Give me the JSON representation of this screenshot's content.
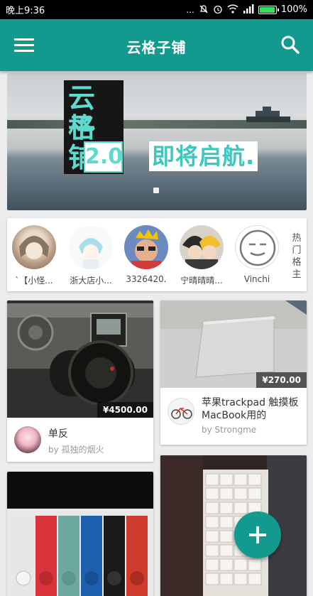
{
  "status_bar": {
    "time": "晚上9:36",
    "dots": "...",
    "battery": "100%",
    "battery_level": 1.0
  },
  "app_bar": {
    "title": "云格子铺",
    "menu_icon": "menu-icon",
    "search_icon": "search-icon",
    "color": "#139a8e"
  },
  "banner": {
    "logo_line1": "云格",
    "logo_line2": "子铺",
    "version": "2.0",
    "tagline": "即将启航."
  },
  "hot_users": {
    "label": "热门格主",
    "users": [
      {
        "name": "`【小怪..."
      },
      {
        "name": "浙大店小..."
      },
      {
        "name": "3326420."
      },
      {
        "name": "宁晴晴晴..."
      },
      {
        "name": "Vinchi"
      }
    ]
  },
  "cards": [
    {
      "price": "¥4500.00",
      "title": "单反",
      "by": "by 孤独的烟火"
    },
    {
      "price": "¥270.00",
      "title": "苹果trackpad 触摸板 MacBook用的",
      "by": "by Strongme"
    }
  ],
  "fab": {
    "icon": "add-icon"
  }
}
